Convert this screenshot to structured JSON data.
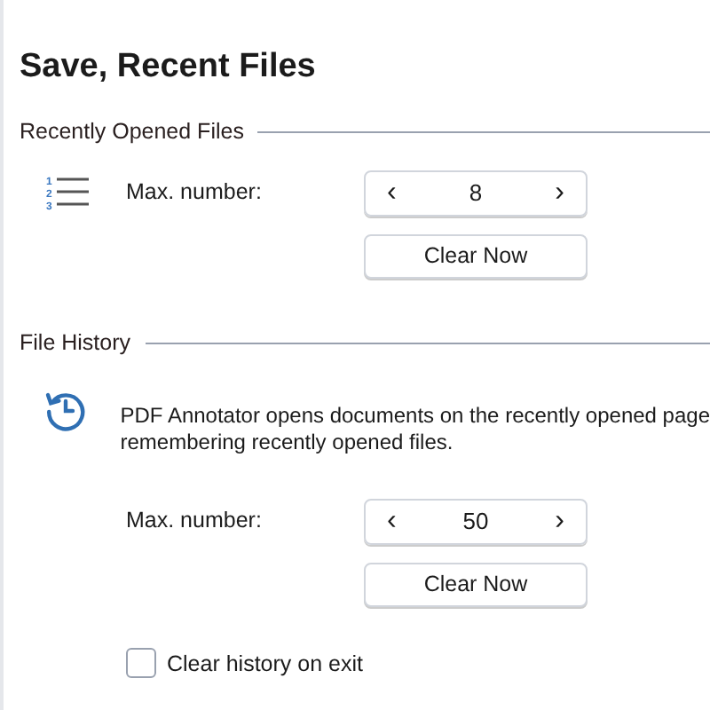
{
  "title": "Save, Recent Files",
  "sections": [
    {
      "kind": "recent",
      "heading": "Recently Opened Files",
      "icon_numbers": [
        "1",
        "2",
        "3"
      ],
      "max_label": "Max. number:",
      "value": "8",
      "decrement": "‹",
      "increment": "›",
      "clear_button": "Clear Now"
    },
    {
      "kind": "history",
      "heading": "File History",
      "description_lines": [
        "PDF Annotator opens documents on the recently opened page",
        "remembering recently opened files."
      ],
      "max_label": "Max. number:",
      "value": "50",
      "decrement": "‹",
      "increment": "›",
      "clear_button": "Clear Now",
      "checkbox": {
        "label": "Clear history on exit",
        "checked": false
      }
    }
  ]
}
